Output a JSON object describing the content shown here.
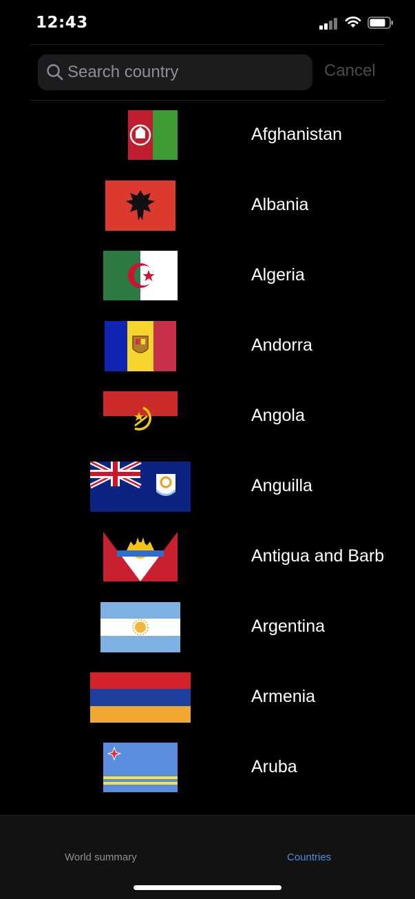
{
  "status_bar": {
    "time": "12:43"
  },
  "search": {
    "placeholder": "Search country",
    "value": "",
    "cancel_label": "Cancel"
  },
  "countries": [
    {
      "name": "Afghanistan",
      "flag_icon": "afghanistan-flag-icon"
    },
    {
      "name": "Albania",
      "flag_icon": "albania-flag-icon"
    },
    {
      "name": "Algeria",
      "flag_icon": "algeria-flag-icon"
    },
    {
      "name": "Andorra",
      "flag_icon": "andorra-flag-icon"
    },
    {
      "name": "Angola",
      "flag_icon": "angola-flag-icon"
    },
    {
      "name": "Anguilla",
      "flag_icon": "anguilla-flag-icon"
    },
    {
      "name": "Antigua and Barbuda",
      "flag_icon": "antigua-and-barbuda-flag-icon"
    },
    {
      "name": "Argentina",
      "flag_icon": "argentina-flag-icon"
    },
    {
      "name": "Armenia",
      "flag_icon": "armenia-flag-icon"
    },
    {
      "name": "Aruba",
      "flag_icon": "aruba-flag-icon"
    }
  ],
  "tabbar": {
    "tabs": [
      {
        "label": "World summary",
        "active": false
      },
      {
        "label": "Countries",
        "active": true
      }
    ],
    "active_color": "#4a90e2",
    "inactive_color": "#8e8e93"
  }
}
